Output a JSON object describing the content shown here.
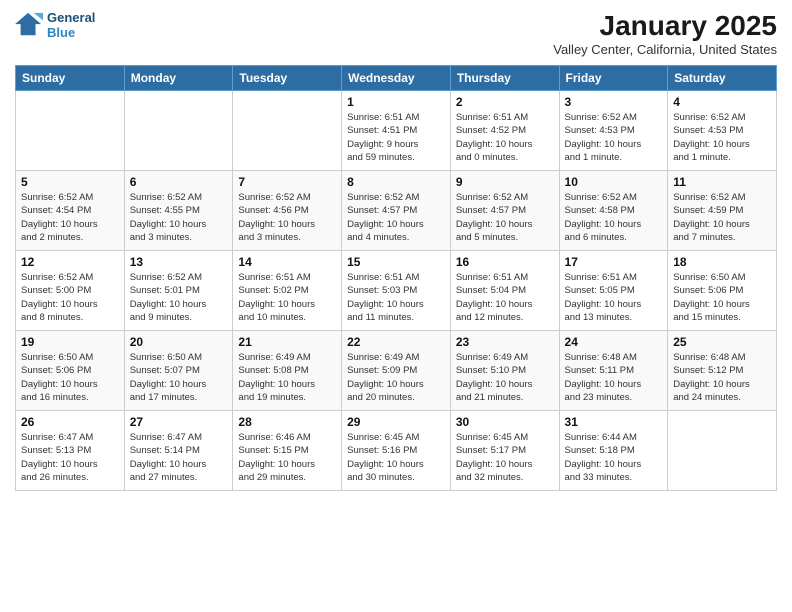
{
  "header": {
    "logo_line1": "General",
    "logo_line2": "Blue",
    "month": "January 2025",
    "location": "Valley Center, California, United States"
  },
  "weekdays": [
    "Sunday",
    "Monday",
    "Tuesday",
    "Wednesday",
    "Thursday",
    "Friday",
    "Saturday"
  ],
  "weeks": [
    [
      {
        "day": "",
        "info": ""
      },
      {
        "day": "",
        "info": ""
      },
      {
        "day": "",
        "info": ""
      },
      {
        "day": "1",
        "info": "Sunrise: 6:51 AM\nSunset: 4:51 PM\nDaylight: 9 hours\nand 59 minutes."
      },
      {
        "day": "2",
        "info": "Sunrise: 6:51 AM\nSunset: 4:52 PM\nDaylight: 10 hours\nand 0 minutes."
      },
      {
        "day": "3",
        "info": "Sunrise: 6:52 AM\nSunset: 4:53 PM\nDaylight: 10 hours\nand 1 minute."
      },
      {
        "day": "4",
        "info": "Sunrise: 6:52 AM\nSunset: 4:53 PM\nDaylight: 10 hours\nand 1 minute."
      }
    ],
    [
      {
        "day": "5",
        "info": "Sunrise: 6:52 AM\nSunset: 4:54 PM\nDaylight: 10 hours\nand 2 minutes."
      },
      {
        "day": "6",
        "info": "Sunrise: 6:52 AM\nSunset: 4:55 PM\nDaylight: 10 hours\nand 3 minutes."
      },
      {
        "day": "7",
        "info": "Sunrise: 6:52 AM\nSunset: 4:56 PM\nDaylight: 10 hours\nand 3 minutes."
      },
      {
        "day": "8",
        "info": "Sunrise: 6:52 AM\nSunset: 4:57 PM\nDaylight: 10 hours\nand 4 minutes."
      },
      {
        "day": "9",
        "info": "Sunrise: 6:52 AM\nSunset: 4:57 PM\nDaylight: 10 hours\nand 5 minutes."
      },
      {
        "day": "10",
        "info": "Sunrise: 6:52 AM\nSunset: 4:58 PM\nDaylight: 10 hours\nand 6 minutes."
      },
      {
        "day": "11",
        "info": "Sunrise: 6:52 AM\nSunset: 4:59 PM\nDaylight: 10 hours\nand 7 minutes."
      }
    ],
    [
      {
        "day": "12",
        "info": "Sunrise: 6:52 AM\nSunset: 5:00 PM\nDaylight: 10 hours\nand 8 minutes."
      },
      {
        "day": "13",
        "info": "Sunrise: 6:52 AM\nSunset: 5:01 PM\nDaylight: 10 hours\nand 9 minutes."
      },
      {
        "day": "14",
        "info": "Sunrise: 6:51 AM\nSunset: 5:02 PM\nDaylight: 10 hours\nand 10 minutes."
      },
      {
        "day": "15",
        "info": "Sunrise: 6:51 AM\nSunset: 5:03 PM\nDaylight: 10 hours\nand 11 minutes."
      },
      {
        "day": "16",
        "info": "Sunrise: 6:51 AM\nSunset: 5:04 PM\nDaylight: 10 hours\nand 12 minutes."
      },
      {
        "day": "17",
        "info": "Sunrise: 6:51 AM\nSunset: 5:05 PM\nDaylight: 10 hours\nand 13 minutes."
      },
      {
        "day": "18",
        "info": "Sunrise: 6:50 AM\nSunset: 5:06 PM\nDaylight: 10 hours\nand 15 minutes."
      }
    ],
    [
      {
        "day": "19",
        "info": "Sunrise: 6:50 AM\nSunset: 5:06 PM\nDaylight: 10 hours\nand 16 minutes."
      },
      {
        "day": "20",
        "info": "Sunrise: 6:50 AM\nSunset: 5:07 PM\nDaylight: 10 hours\nand 17 minutes."
      },
      {
        "day": "21",
        "info": "Sunrise: 6:49 AM\nSunset: 5:08 PM\nDaylight: 10 hours\nand 19 minutes."
      },
      {
        "day": "22",
        "info": "Sunrise: 6:49 AM\nSunset: 5:09 PM\nDaylight: 10 hours\nand 20 minutes."
      },
      {
        "day": "23",
        "info": "Sunrise: 6:49 AM\nSunset: 5:10 PM\nDaylight: 10 hours\nand 21 minutes."
      },
      {
        "day": "24",
        "info": "Sunrise: 6:48 AM\nSunset: 5:11 PM\nDaylight: 10 hours\nand 23 minutes."
      },
      {
        "day": "25",
        "info": "Sunrise: 6:48 AM\nSunset: 5:12 PM\nDaylight: 10 hours\nand 24 minutes."
      }
    ],
    [
      {
        "day": "26",
        "info": "Sunrise: 6:47 AM\nSunset: 5:13 PM\nDaylight: 10 hours\nand 26 minutes."
      },
      {
        "day": "27",
        "info": "Sunrise: 6:47 AM\nSunset: 5:14 PM\nDaylight: 10 hours\nand 27 minutes."
      },
      {
        "day": "28",
        "info": "Sunrise: 6:46 AM\nSunset: 5:15 PM\nDaylight: 10 hours\nand 29 minutes."
      },
      {
        "day": "29",
        "info": "Sunrise: 6:45 AM\nSunset: 5:16 PM\nDaylight: 10 hours\nand 30 minutes."
      },
      {
        "day": "30",
        "info": "Sunrise: 6:45 AM\nSunset: 5:17 PM\nDaylight: 10 hours\nand 32 minutes."
      },
      {
        "day": "31",
        "info": "Sunrise: 6:44 AM\nSunset: 5:18 PM\nDaylight: 10 hours\nand 33 minutes."
      },
      {
        "day": "",
        "info": ""
      }
    ]
  ]
}
